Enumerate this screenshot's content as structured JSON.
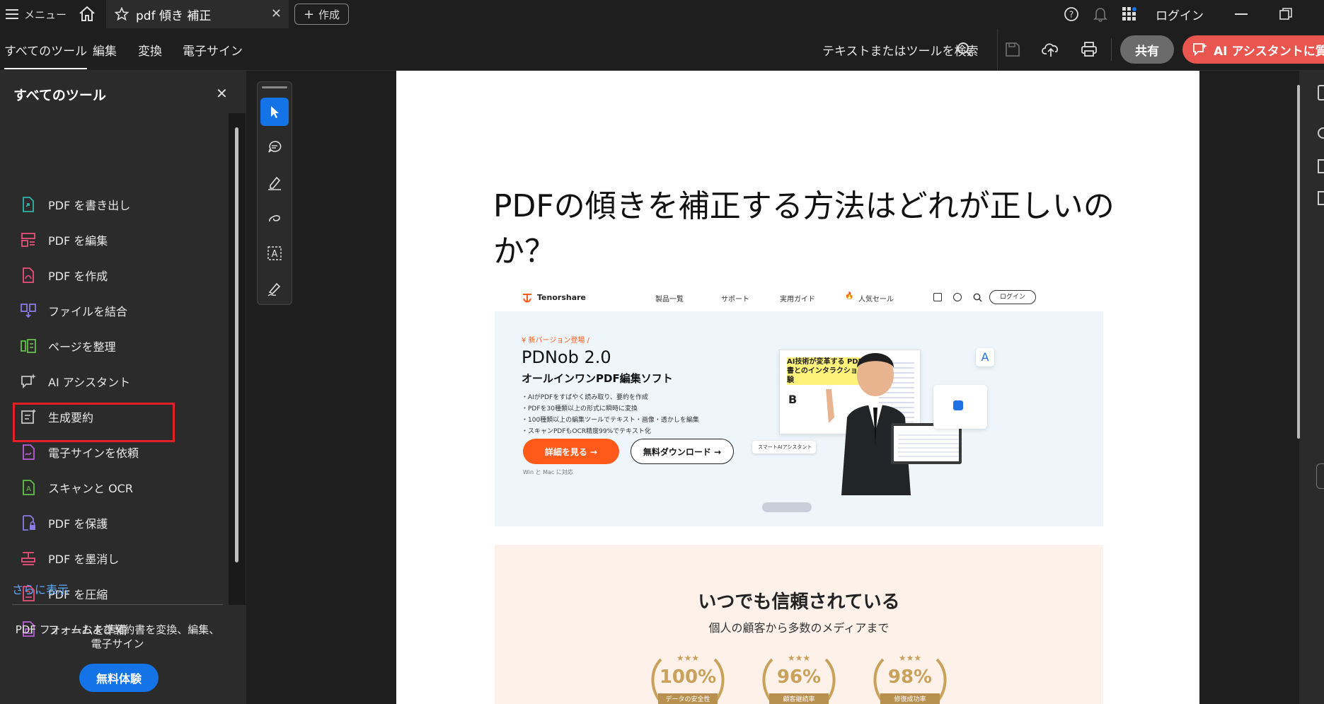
{
  "titlebar": {
    "menu_label": "メニュー",
    "tab_title": "pdf 傾き 補正",
    "create_label": "作成",
    "login_label": "ログイン"
  },
  "toolbar": {
    "tabs": [
      "すべてのツール",
      "編集",
      "変換",
      "電子サイン"
    ],
    "search_label": "テキストまたはツールを検索",
    "share_label": "共有",
    "ai_label": "AI アシスタントに質問"
  },
  "sidebar": {
    "title": "すべてのツール",
    "items": [
      {
        "label": "PDF を書き出し",
        "icon": "export-pdf-icon",
        "color": "#2fb5a8"
      },
      {
        "label": "PDF を編集",
        "icon": "edit-pdf-icon",
        "color": "#e9517c"
      },
      {
        "label": "PDF を作成",
        "icon": "create-pdf-icon",
        "color": "#e9517c"
      },
      {
        "label": "ファイルを結合",
        "icon": "combine-files-icon",
        "color": "#8b7be6"
      },
      {
        "label": "ページを整理",
        "icon": "organize-pages-icon",
        "color": "#62c14a"
      },
      {
        "label": "AI アシスタント",
        "icon": "ai-assistant-icon",
        "color": "#c6c6c6"
      },
      {
        "label": "生成要約",
        "icon": "summary-icon",
        "color": "#c6c6c6"
      },
      {
        "label": "電子サインを依頼",
        "icon": "request-esign-icon",
        "color": "#b95fd6"
      },
      {
        "label": "スキャンと OCR",
        "icon": "scan-ocr-icon",
        "color": "#62c14a"
      },
      {
        "label": "PDF を保護",
        "icon": "protect-pdf-icon",
        "color": "#8b7be6"
      },
      {
        "label": "PDF を墨消し",
        "icon": "redact-pdf-icon",
        "color": "#e9517c"
      },
      {
        "label": "PDF を圧縮",
        "icon": "compress-pdf-icon",
        "color": "#e9517c"
      },
      {
        "label": "フォームを準備",
        "icon": "prepare-form-icon",
        "color": "#b95fd6"
      }
    ],
    "more_label": "さらに表示",
    "promo_text": "PDF フォームおよび契約書を変換、編集、電子サイン",
    "trial_label": "無料体験"
  },
  "document": {
    "title": "PDFの傾きを補正する方法はどれが正しいのか？",
    "site": {
      "brand": "Tenorshare",
      "nav": [
        "製品一覧",
        "サポート",
        "実用ガイド",
        "人気セール"
      ],
      "login": "ログイン",
      "new_badge": "¥ 新バージョン登場 /",
      "product": "PDNob 2.0",
      "tagline": "オールインワンPDF編集ソフト",
      "bullets": [
        "・AIがPDFをすばやく読み取り、要約を作成",
        "・PDFを30種類以上の形式に瞬時に変換",
        "・100種類以上の編集ツールでテキスト・画像・透かしを編集",
        "・スキャンPDFもOCR精度99%でテキスト化"
      ],
      "btn_detail": "詳細を見る →",
      "btn_download": "無料ダウンロード →",
      "compat": "Win と Mac に対応",
      "promo_heading": "AI技術が変革する PDF文書とのインタラクション体験",
      "assistant_chip": "スマートAIアシスタント"
    },
    "trust": {
      "title": "いつでも信頼されている",
      "subtitle": "個人の顧客から多数のメディアまで",
      "badges": [
        {
          "pct": "100%",
          "label": "データの安全性"
        },
        {
          "pct": "96%",
          "label": "顧客継続率"
        },
        {
          "pct": "98%",
          "label": "修復成功率"
        }
      ]
    }
  }
}
